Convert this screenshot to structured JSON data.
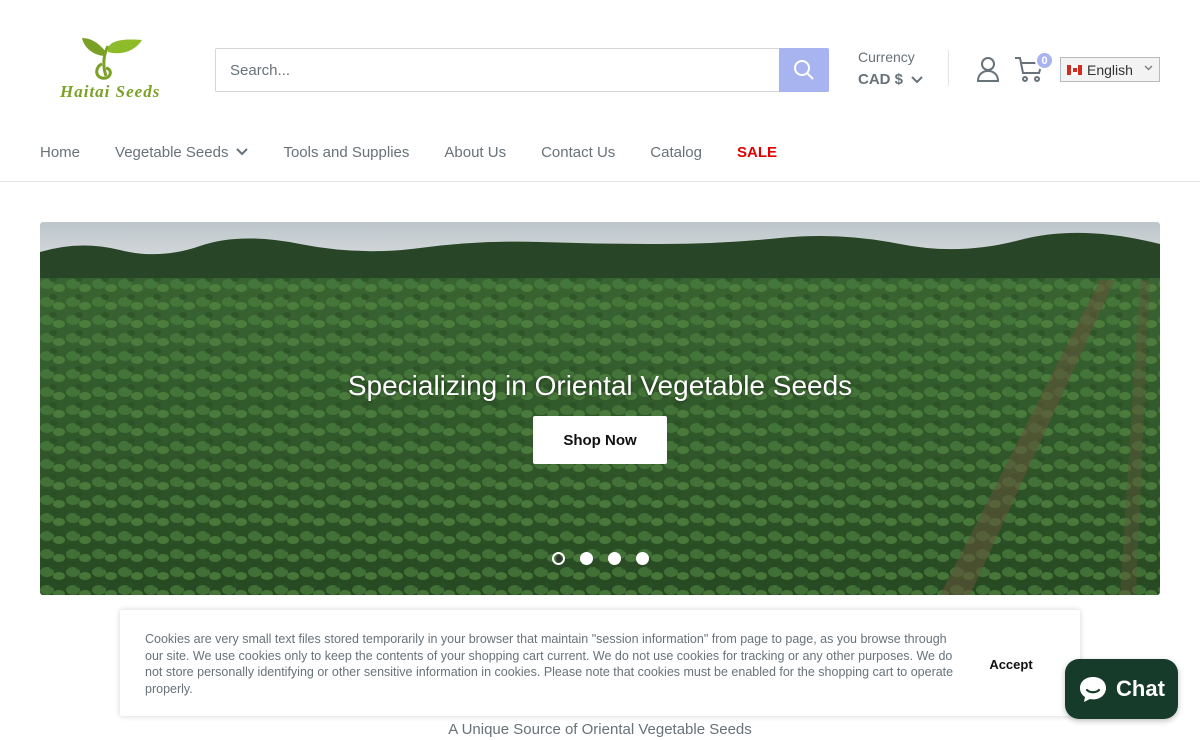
{
  "brand": {
    "name": "Haitai Seeds",
    "logo_color": "#7aa126"
  },
  "search": {
    "placeholder": "Search...",
    "button_color": "#a8b4ef"
  },
  "currency": {
    "label": "Currency",
    "value": "CAD $"
  },
  "cart": {
    "count": "0"
  },
  "language": {
    "selected": "English",
    "flag": "canada-flag-icon"
  },
  "nav": {
    "items": [
      {
        "label": "Home"
      },
      {
        "label": "Vegetable Seeds",
        "has_dropdown": true
      },
      {
        "label": "Tools and Supplies"
      },
      {
        "label": "About Us"
      },
      {
        "label": "Contact Us"
      },
      {
        "label": "Catalog"
      },
      {
        "label": "SALE",
        "color": "#e00000"
      }
    ]
  },
  "hero": {
    "title": "Specializing in Oriental Vegetable Seeds",
    "button_label": "Shop Now",
    "slide_count": 4,
    "active_slide": 1
  },
  "cookie": {
    "text": "Cookies are very small text files stored temporarily in your browser that maintain \"session information\" from page to page, as you browse through our site. We use cookies only to keep the contents of your shopping cart current. We do not use cookies for tracking or any other purposes. We do not store personally identifying or other sensitive information in cookies. Please note that cookies must be enabled for the shopping cart to operate properly.",
    "accept_label": "Accept"
  },
  "tagline": "A Unique Source of Oriental Vegetable Seeds",
  "chat": {
    "label": "Chat",
    "color": "#163b2a"
  },
  "colors": {
    "text_muted": "#677279",
    "sale": "#e00000",
    "accent": "#a8b4ef"
  }
}
